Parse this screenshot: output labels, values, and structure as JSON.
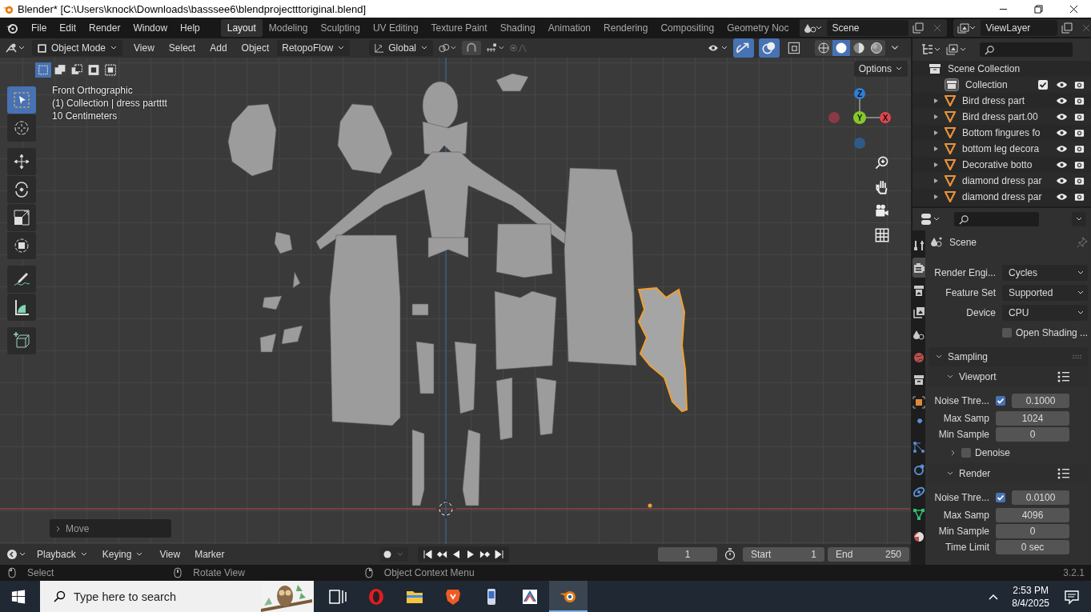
{
  "window": {
    "title": "Blender* [C:\\Users\\knock\\Downloads\\basssee6\\blendprojectttoriginal.blend]"
  },
  "menu": [
    "File",
    "Edit",
    "Render",
    "Window",
    "Help"
  ],
  "workspaces": [
    {
      "label": "Layout",
      "selected": true
    },
    {
      "label": "Modeling",
      "selected": false
    },
    {
      "label": "Sculpting",
      "selected": false
    },
    {
      "label": "UV Editing",
      "selected": false
    },
    {
      "label": "Texture Paint",
      "selected": false
    },
    {
      "label": "Shading",
      "selected": false
    },
    {
      "label": "Animation",
      "selected": false
    },
    {
      "label": "Rendering",
      "selected": false
    },
    {
      "label": "Compositing",
      "selected": false
    },
    {
      "label": "Geometry Noc",
      "selected": false
    }
  ],
  "scene": "Scene",
  "view_layer": "ViewLayer",
  "viewport_header": {
    "mode": "Object Mode",
    "menus": [
      "View",
      "Select",
      "Add",
      "Object"
    ],
    "addon": "RetopoFlow",
    "orientation": "Global",
    "gizmos_on": true,
    "overlays_on": true,
    "xray_on": false,
    "shading": [
      {
        "kind": "wireframe",
        "selected": false
      },
      {
        "kind": "solid",
        "selected": true
      },
      {
        "kind": "material",
        "selected": false
      },
      {
        "kind": "rendered",
        "selected": false
      }
    ]
  },
  "select_modes": [
    {
      "kind": "set",
      "selected": true
    },
    {
      "kind": "extend",
      "selected": false
    },
    {
      "kind": "subtract",
      "selected": false
    },
    {
      "kind": "invert",
      "selected": false
    },
    {
      "kind": "intersect",
      "selected": false
    }
  ],
  "options": "Options",
  "viewport_info": [
    "Front Orthographic",
    "(1) Collection | dress partttt",
    "10 Centimeters"
  ],
  "gizmo": {
    "x": "X",
    "y": "Y",
    "z": "Z"
  },
  "tools": [
    {
      "kind": "select",
      "selected": true
    },
    {
      "kind": "cursor",
      "selected": false
    },
    {
      "kind": "move",
      "selected": false
    },
    {
      "kind": "rotate",
      "selected": false
    },
    {
      "kind": "scale",
      "selected": false
    },
    {
      "kind": "transform",
      "selected": false
    },
    {
      "kind": "annotate",
      "selected": false
    },
    {
      "kind": "measure",
      "selected": false
    },
    {
      "kind": "add-cube",
      "selected": false
    }
  ],
  "last_operator": "Move",
  "outliner": {
    "root": "Scene Collection",
    "collection": {
      "name": "Collection",
      "checked": true,
      "children": [
        {
          "name": "Bird dress part",
          "expanded": false
        },
        {
          "name": "Bird dress part.00",
          "expanded": false
        },
        {
          "name": "Bottom fingures fo",
          "expanded": false
        },
        {
          "name": "bottom leg decora",
          "expanded": false
        },
        {
          "name": "Decorative botto",
          "expanded": false
        },
        {
          "name": "diamond dress par",
          "expanded": false
        },
        {
          "name": "diamond dress par",
          "expanded": false
        }
      ]
    }
  },
  "properties": {
    "title": "Scene",
    "tabs": [
      {
        "kind": "tool",
        "selected": false,
        "color": "#c8c8c8"
      },
      {
        "kind": "render",
        "selected": true,
        "color": "#c8c8c8"
      },
      {
        "kind": "output",
        "selected": false,
        "color": "#c8c8c8"
      },
      {
        "kind": "view-layer",
        "selected": false,
        "color": "#c8c8c8"
      },
      {
        "kind": "scene",
        "selected": false,
        "color": "#c8c8c8"
      },
      {
        "kind": "world",
        "selected": false,
        "color": "#c0504d"
      },
      {
        "kind": "collection",
        "selected": false,
        "color": "#c8c8c8"
      },
      {
        "kind": "object",
        "selected": false,
        "color": "#e0883a"
      },
      {
        "kind": "modifier",
        "selected": false,
        "color": "#5a8fd6"
      },
      {
        "kind": "particles",
        "selected": false,
        "color": "#5a8fd6"
      },
      {
        "kind": "physics",
        "selected": false,
        "color": "#5a8fd6"
      },
      {
        "kind": "constraints",
        "selected": false,
        "color": "#5a8fd6"
      },
      {
        "kind": "data",
        "selected": false,
        "color": "#2fbf71"
      },
      {
        "kind": "material",
        "selected": false,
        "color": "#c0504d"
      }
    ],
    "fields": [
      {
        "label": "Render Engi...",
        "value": "Cycles"
      },
      {
        "label": "Feature Set",
        "value": "Supported"
      },
      {
        "label": "Device",
        "value": "CPU"
      }
    ],
    "open_shading": {
      "label": "Open Shading ...",
      "checked": false
    },
    "sampling": {
      "title": "Sampling",
      "expanded": true,
      "subpanels": [
        {
          "title": "Viewport",
          "expanded": true,
          "rows": [
            {
              "kind": "check_number",
              "label": "Noise Thre...",
              "checked": true,
              "value": "0.1000"
            },
            {
              "kind": "number",
              "label": "Max Samp",
              "value": "1024"
            },
            {
              "kind": "number",
              "label": "Min Sample",
              "value": "0"
            },
            {
              "kind": "subpanel",
              "label": "Denoise",
              "checked": false,
              "expanded": false
            }
          ]
        },
        {
          "title": "Render",
          "expanded": true,
          "rows": [
            {
              "kind": "check_number",
              "label": "Noise Thre...",
              "checked": true,
              "value": "0.0100"
            },
            {
              "kind": "number",
              "label": "Max Samp",
              "value": "4096"
            },
            {
              "kind": "number",
              "label": "Min Sample",
              "value": "0"
            },
            {
              "kind": "number",
              "label": "Time Limit",
              "value": "0 sec"
            }
          ]
        }
      ]
    }
  },
  "timeline": {
    "menus": [
      "Playback",
      "Keying",
      "View",
      "Marker"
    ],
    "current_frame": "1",
    "start_label": "Start",
    "start": "1",
    "end_label": "End",
    "end": "250"
  },
  "status_bar": {
    "hints": [
      "Select",
      "Rotate View",
      "Object Context Menu"
    ],
    "version": "3.2.1"
  },
  "taskbar": {
    "search_placeholder": "Type here to search",
    "time": "2:53 PM",
    "date": "8/4/2025",
    "apps": [
      {
        "kind": "task-view",
        "selected": false
      },
      {
        "kind": "opera",
        "selected": false
      },
      {
        "kind": "files",
        "selected": false
      },
      {
        "kind": "brave",
        "selected": false
      },
      {
        "kind": "device",
        "selected": false
      },
      {
        "kind": "book",
        "selected": false
      },
      {
        "kind": "blender",
        "selected": true
      }
    ]
  }
}
